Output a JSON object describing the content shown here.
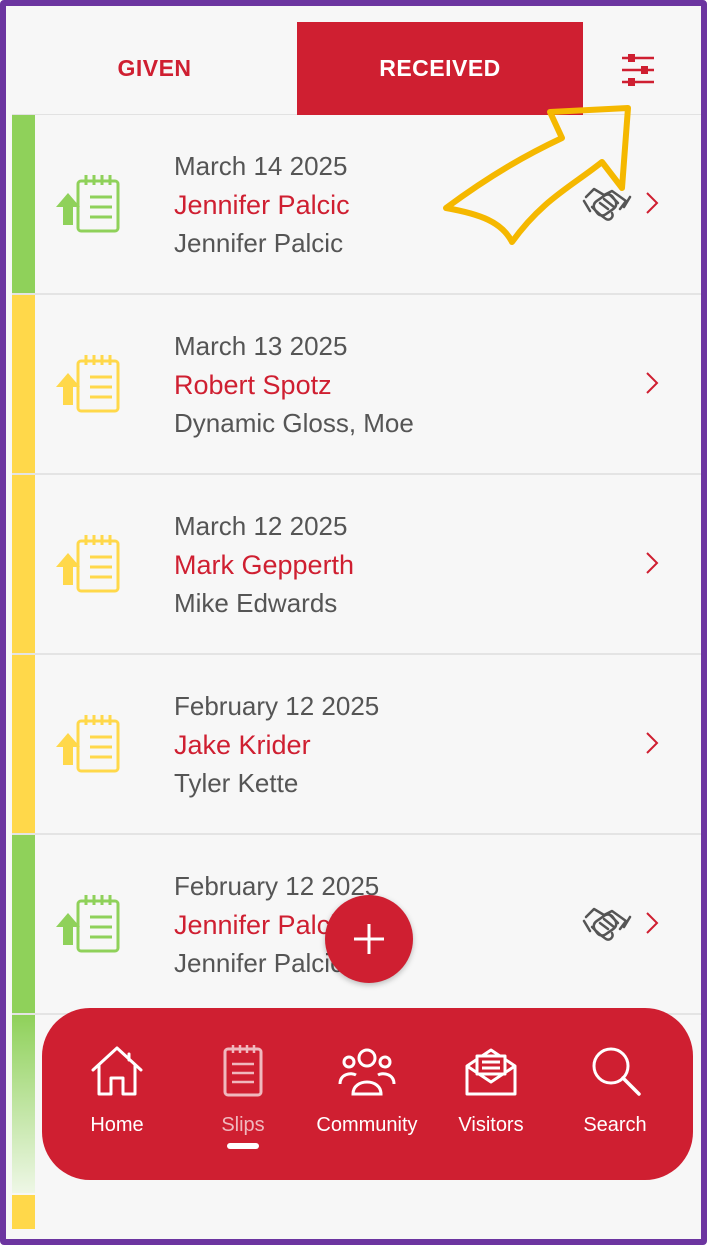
{
  "tabs": {
    "given": "GIVEN",
    "received": "RECEIVED",
    "active": "received"
  },
  "filter_icon": "sliders-icon",
  "slips": [
    {
      "date": "March 14 2025",
      "from": "Jennifer Palcic",
      "to": "Jennifer Palcic",
      "status_color": "#8fd15a",
      "handshake": true
    },
    {
      "date": "March 13 2025",
      "from": "Robert Spotz",
      "to": "Dynamic Gloss, Moe",
      "status_color": "#ffd84a",
      "handshake": false
    },
    {
      "date": "March 12 2025",
      "from": "Mark Gepperth",
      "to": "Mike Edwards",
      "status_color": "#ffd84a",
      "handshake": false
    },
    {
      "date": "February 12 2025",
      "from": "Jake Krider",
      "to": "Tyler Kette",
      "status_color": "#ffd84a",
      "handshake": false
    },
    {
      "date": "February 12 2025",
      "from": "Jennifer Palcic",
      "to": "Jennifer Palcic",
      "status_color": "#8fd15a",
      "handshake": true
    }
  ],
  "colors": {
    "accent": "#cf1f31",
    "green": "#8fd15a",
    "yellow": "#ffd84a",
    "annotation": "#f5b800"
  },
  "fab": {
    "icon": "plus-icon"
  },
  "nav": {
    "items": [
      {
        "label": "Home",
        "icon": "home-icon"
      },
      {
        "label": "Slips",
        "icon": "slips-icon",
        "active": true
      },
      {
        "label": "Community",
        "icon": "community-icon"
      },
      {
        "label": "Visitors",
        "icon": "visitors-icon"
      },
      {
        "label": "Search",
        "icon": "search-icon"
      }
    ]
  }
}
